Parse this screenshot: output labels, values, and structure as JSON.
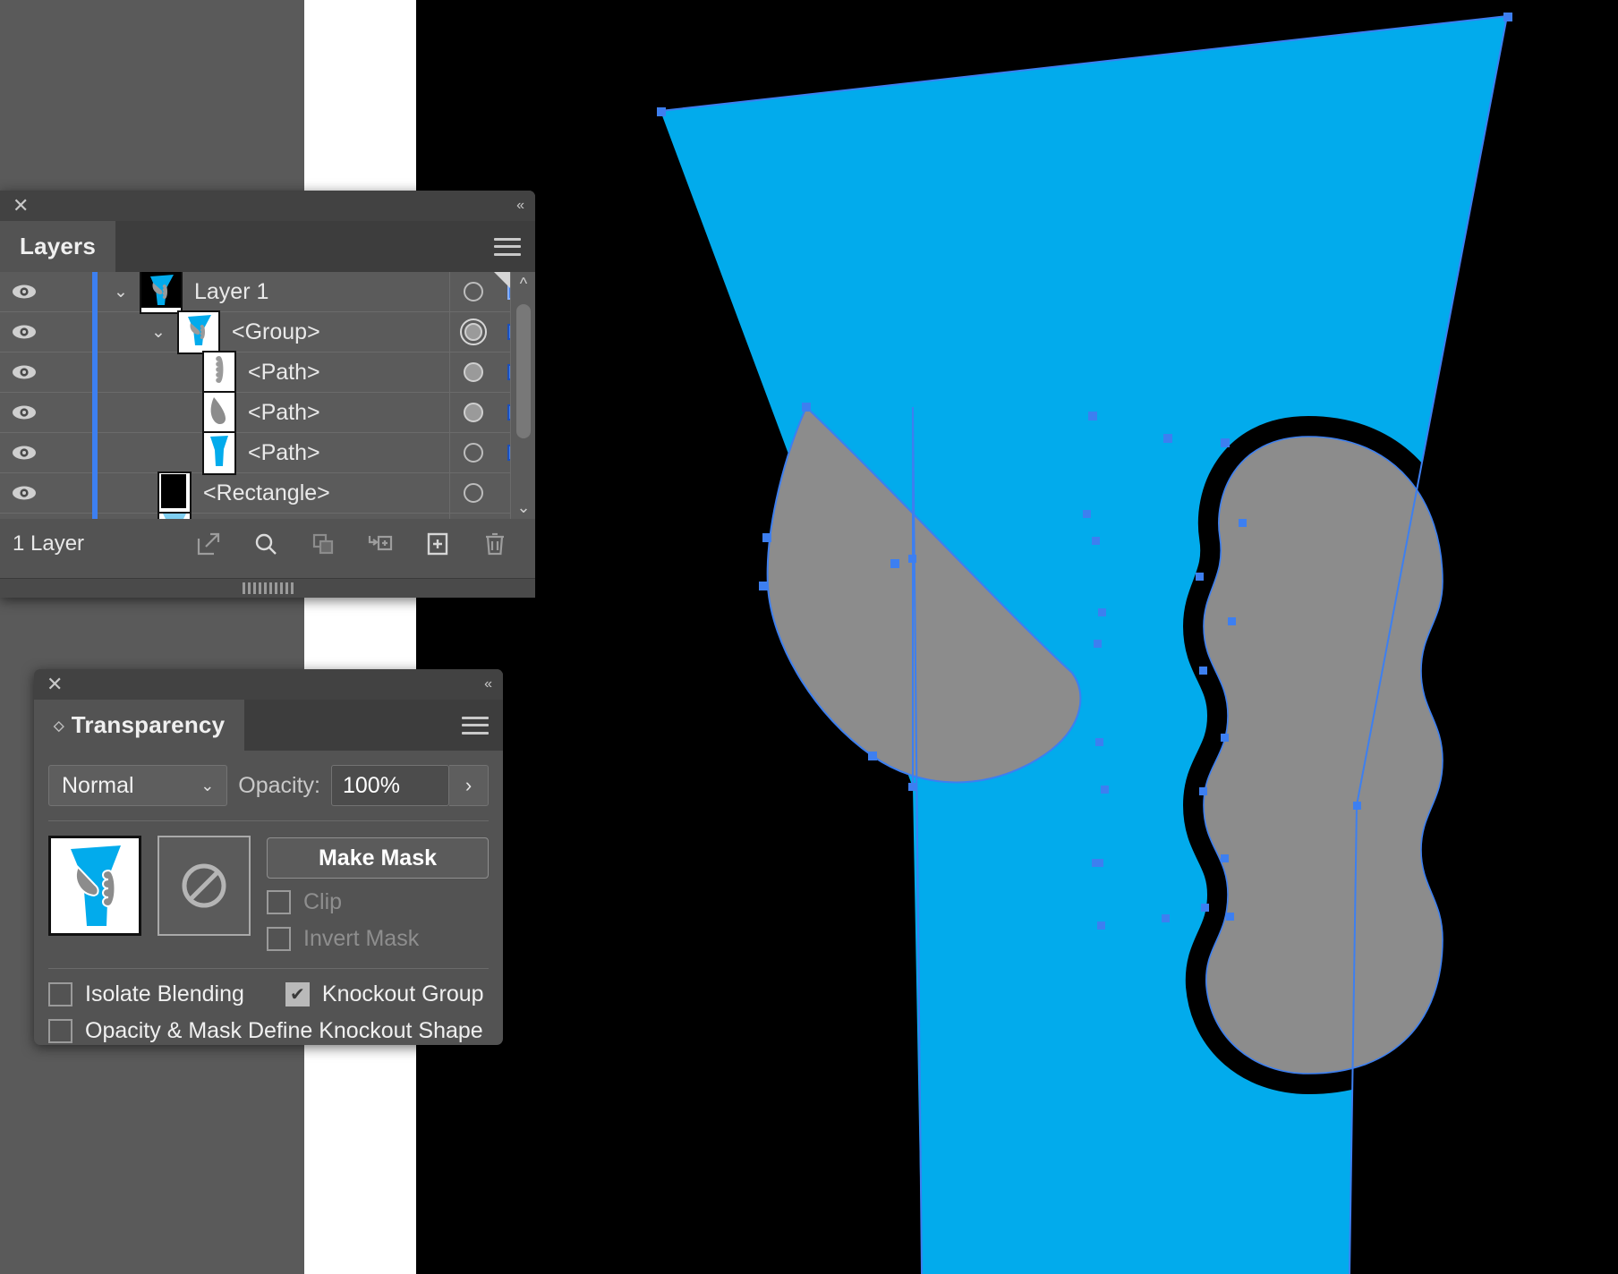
{
  "app": {
    "accent_blue": "#02abec",
    "selection_blue": "#3d7ff0",
    "artwork_gray": "#8c8c8c",
    "panel_bg": "#535353",
    "canvas_black": "#000000"
  },
  "layers_panel": {
    "close_icon": "close-icon",
    "collapse_icon": "collapse-panel-icon",
    "tab_title": "Layers",
    "menu_icon": "panel-menu-icon",
    "footer_count": "1 Layer",
    "footer_buttons": [
      {
        "name": "release-to-layers-button",
        "icon": "export-arrow-icon"
      },
      {
        "name": "locate-object-button",
        "icon": "search-icon"
      },
      {
        "name": "make-sublayer-button",
        "icon": "duplicate-layers-icon"
      },
      {
        "name": "create-new-sublayer-button",
        "icon": "new-sublayer-icon"
      },
      {
        "name": "create-new-layer-button",
        "icon": "plus-square-icon"
      },
      {
        "name": "delete-selection-button",
        "icon": "trash-icon"
      }
    ],
    "rows": [
      {
        "label": "Layer 1",
        "indent": 0,
        "disclosure": "expanded",
        "thumb": "layer1-thumb",
        "target": "hollow",
        "select_swatch": true,
        "visible": true,
        "color_bar": "#3d7ff0"
      },
      {
        "label": "<Group>",
        "indent": 1,
        "disclosure": "expanded",
        "thumb": "group-thumb",
        "target": "double-ring",
        "select_swatch": true,
        "visible": true,
        "color_bar": "#3d7ff0"
      },
      {
        "label": "<Path>",
        "indent": 2,
        "disclosure": "none",
        "thumb": "path-beads-thumb",
        "target": "filled",
        "select_swatch": true,
        "visible": true,
        "color_bar": "#3d7ff0"
      },
      {
        "label": "<Path>",
        "indent": 2,
        "disclosure": "none",
        "thumb": "path-leaf-thumb",
        "target": "filled",
        "select_swatch": true,
        "visible": true,
        "color_bar": "#3d7ff0"
      },
      {
        "label": "<Path>",
        "indent": 2,
        "disclosure": "none",
        "thumb": "path-cone-thumb",
        "target": "hollow",
        "select_swatch": true,
        "visible": true,
        "color_bar": "#3d7ff0"
      },
      {
        "label": "<Rectangle>",
        "indent": 2,
        "disclosure": "none",
        "thumb": "rect-black-thumb",
        "target": "hollow",
        "select_swatch": false,
        "visible": true,
        "color_bar": "#3d7ff0"
      }
    ]
  },
  "transparency_panel": {
    "close_icon": "close-icon",
    "collapse_icon": "collapse-panel-icon",
    "tab_title": "Transparency",
    "menu_icon": "panel-menu-icon",
    "blend_mode": "Normal",
    "opacity_label": "Opacity:",
    "opacity_value": "100%",
    "stepper_glyph": "›",
    "make_mask_label": "Make Mask",
    "clip_label": "Clip",
    "clip_checked": false,
    "clip_disabled": true,
    "invert_mask_label": "Invert Mask",
    "invert_mask_checked": false,
    "invert_mask_disabled": true,
    "isolate_blending_label": "Isolate Blending",
    "isolate_blending_checked": false,
    "knockout_group_label": "Knockout Group",
    "knockout_group_checked": true,
    "opacity_mask_label": "Opacity & Mask Define Knockout Shape",
    "opacity_mask_checked": false,
    "artwork_thumb": "artwork-preview-thumb",
    "mask_thumb": "no-mask-icon"
  },
  "canvas": {
    "shapes": [
      {
        "name": "cone-shape",
        "fill": "#02abec",
        "desc": "large blue tapered cone"
      },
      {
        "name": "leaf-shape",
        "fill": "#8c8c8c",
        "desc": "gray teardrop/leaf on left"
      },
      {
        "name": "beads-shape",
        "fill": "#8c8c8c",
        "desc": "gray stacked beads column on right"
      }
    ],
    "anchor_point_color": "#3d7ff0",
    "path_outline_color": "#3d7ff0"
  }
}
